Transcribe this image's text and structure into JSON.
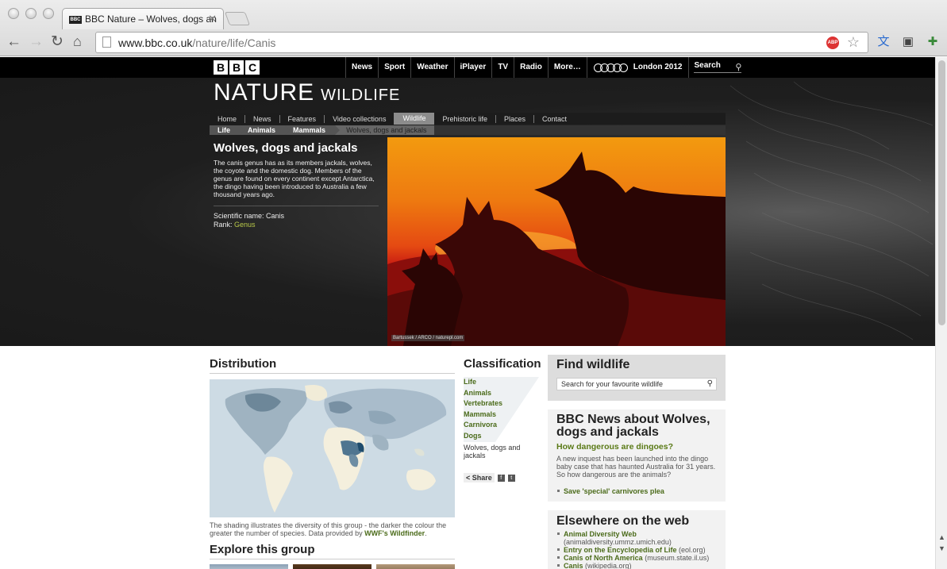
{
  "browser": {
    "tab_title": "BBC Nature – Wolves, dogs an",
    "tab_favicon": "BBC",
    "url_domain": "www.bbc.co.uk",
    "url_path": "/nature/life/Canis",
    "abp_label": "ABP",
    "icons": {
      "back": "back-arrow-icon",
      "forward": "forward-arrow-icon",
      "reload": "reload-icon",
      "home": "home-icon",
      "star": "star-icon",
      "close": "close-icon"
    }
  },
  "bbc_bar": {
    "logo": [
      "B",
      "B",
      "C"
    ],
    "nav": [
      "News",
      "Sport",
      "Weather",
      "iPlayer",
      "TV",
      "Radio",
      "More…"
    ],
    "olympics": "London 2012",
    "search_label": "Search"
  },
  "site": {
    "title": "NATURE",
    "section": "WILDLIFE",
    "nav": [
      "Home",
      "News",
      "Features",
      "Video collections",
      "Wildlife",
      "Prehistoric life",
      "Places",
      "Contact"
    ],
    "active_nav": "Wildlife",
    "breadcrumb": [
      "Life",
      "Animals",
      "Mammals"
    ],
    "breadcrumb_current": "Wolves, dogs and jackals"
  },
  "species": {
    "name": "Wolves, dogs and jackals",
    "description": "The canis genus has as its members jackals, wolves, the coyote and the domestic dog. Members of the genus are found on every continent except Antarctica, the dingo having been introduced to Australia a few thousand years ago.",
    "scientific_label": "Scientific name:",
    "scientific_name": "Canis",
    "rank_label": "Rank:",
    "rank": "Genus",
    "photo_credit": "Bartussek / ARCO / naturepl.com"
  },
  "distribution": {
    "heading": "Distribution",
    "caption": "The shading illustrates the diversity of this group - the darker the colour the greater the number of species. Data provided by",
    "source_link": "WWF's Wildfinder",
    "caption_end": "."
  },
  "explore": {
    "heading": "Explore this group"
  },
  "classification": {
    "heading": "Classification",
    "levels": [
      "Life",
      "Animals",
      "Vertebrates",
      "Mammals",
      "Carnivora",
      "Dogs"
    ],
    "current": "Wolves, dogs and jackals",
    "share_label": "Share"
  },
  "find_wildlife": {
    "heading": "Find wildlife",
    "placeholder": "Search for your favourite wildlife"
  },
  "news": {
    "heading": "BBC News about Wolves, dogs and jackals",
    "headline": "How dangerous are dingoes?",
    "summary": "A new inquest has been launched into the dingo baby case that has haunted Australia for 31 years. So how dangerous are the animals?",
    "links": [
      "Save 'special' carnivores plea"
    ]
  },
  "elsewhere": {
    "heading": "Elsewhere on the web",
    "links": [
      {
        "title": "Animal Diversity Web",
        "source": "(animaldiversity.ummz.umich.edu)"
      },
      {
        "title": "Entry on the Encyclopedia of Life",
        "source": "(eol.org)"
      },
      {
        "title": "Canis of North America",
        "source": "(museum.state.il.us)"
      },
      {
        "title": "Canis",
        "source": "(wikipedia.org)"
      }
    ]
  }
}
